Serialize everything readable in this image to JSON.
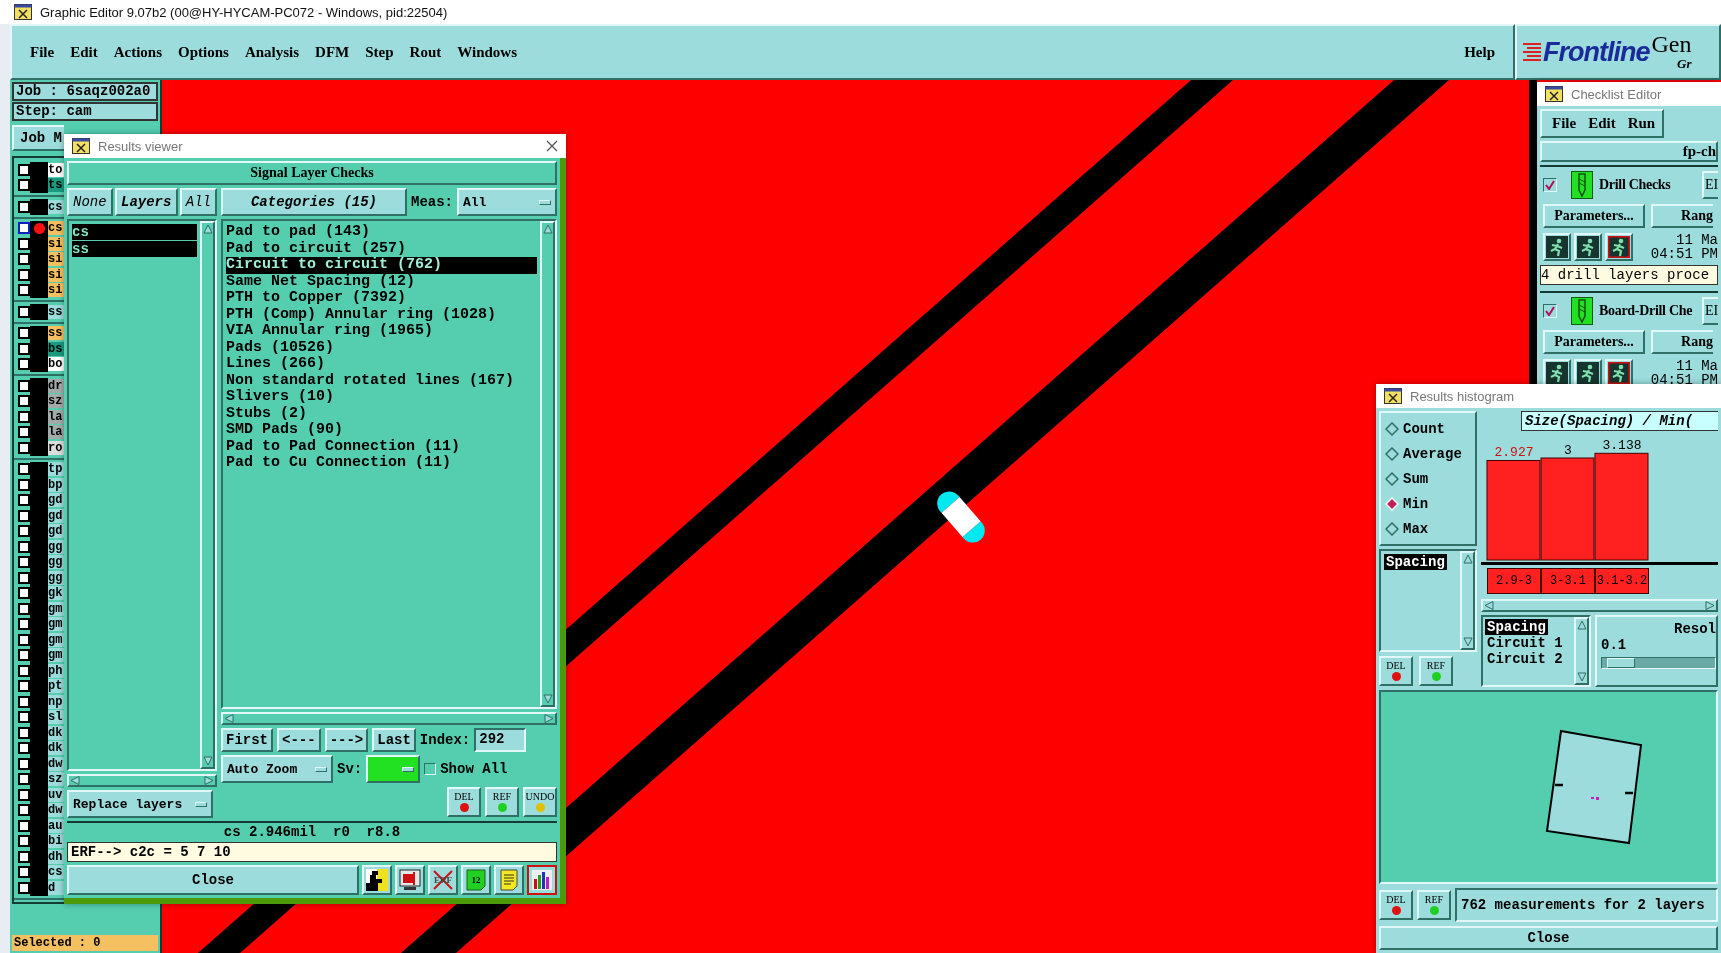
{
  "title_bar": {
    "title": "Graphic Editor 9.07b2 (00@HY-HYCAM-PC072 - Windows, pid:22504)"
  },
  "menu": {
    "items": [
      "File",
      "Edit",
      "Actions",
      "Options",
      "Analysis",
      "DFM",
      "Step",
      "Rout",
      "Windows"
    ],
    "help": "Help"
  },
  "logo": {
    "brand": "Frontline",
    "product": "Gen",
    "tagline": "Gr"
  },
  "job_panel": {
    "job": "Job : 6saqz002a0",
    "step": "Step: cam",
    "matrix_button": "Job M",
    "selected": "Selected : 0",
    "layer_groups": [
      [
        {
          "name": "to",
          "color": "#ffffff",
          "active": false,
          "checked": false
        },
        {
          "name": "ts",
          "color": "#1a9a80",
          "active": false,
          "checked": false
        }
      ],
      [
        {
          "name": "cs",
          "color": "#9cdcdc",
          "active": false,
          "checked": false
        }
      ],
      [
        {
          "name": "cs",
          "color": "#f5c060",
          "active": true,
          "checked": false
        },
        {
          "name": "si",
          "color": "#f5c060",
          "active": false,
          "checked": false
        },
        {
          "name": "si",
          "color": "#f5c060",
          "active": false,
          "checked": false
        },
        {
          "name": "si",
          "color": "#f5c060",
          "active": false,
          "checked": false
        },
        {
          "name": "si",
          "color": "#f5c060",
          "active": false,
          "checked": false
        }
      ],
      [
        {
          "name": "ss",
          "color": "#9cdcdc",
          "active": false,
          "checked": false
        }
      ],
      [
        {
          "name": "ss",
          "color": "#f5c060",
          "active": false,
          "checked": false
        },
        {
          "name": "bs",
          "color": "#1a9a80",
          "active": false,
          "checked": false
        },
        {
          "name": "bo",
          "color": "#ffffff",
          "active": false,
          "checked": false
        }
      ],
      [
        {
          "name": "dr",
          "color": "#a3aaaa",
          "active": false,
          "checked": false
        },
        {
          "name": "sz",
          "color": "#a3aaaa",
          "active": false,
          "checked": false
        },
        {
          "name": "la",
          "color": "#a3aaaa",
          "active": false,
          "checked": false
        },
        {
          "name": "la",
          "color": "#a3aaaa",
          "active": false,
          "checked": false
        },
        {
          "name": "ro",
          "color": "#dcdede",
          "active": false,
          "checked": false
        }
      ],
      [
        {
          "name": "tp",
          "color": "#9cdcdc",
          "active": false,
          "checked": false
        },
        {
          "name": "bp",
          "color": "#9cdcdc",
          "active": false,
          "checked": false
        },
        {
          "name": "gd",
          "color": "#9cdcdc",
          "active": false,
          "checked": false
        },
        {
          "name": "gd",
          "color": "#9cdcdc",
          "active": false,
          "checked": false
        },
        {
          "name": "gd",
          "color": "#9cdcdc",
          "active": false,
          "checked": false
        },
        {
          "name": "gg",
          "color": "#9cdcdc",
          "active": false,
          "checked": false
        },
        {
          "name": "gg",
          "color": "#9cdcdc",
          "active": false,
          "checked": false
        },
        {
          "name": "gg",
          "color": "#9cdcdc",
          "active": false,
          "checked": false
        },
        {
          "name": "gk",
          "color": "#9cdcdc",
          "active": false,
          "checked": false
        },
        {
          "name": "gm",
          "color": "#9cdcdc",
          "active": false,
          "checked": false
        },
        {
          "name": "gm",
          "color": "#9cdcdc",
          "active": false,
          "checked": false
        },
        {
          "name": "gm",
          "color": "#9cdcdc",
          "active": false,
          "checked": false
        },
        {
          "name": "gm",
          "color": "#9cdcdc",
          "active": false,
          "checked": false
        },
        {
          "name": "ph",
          "color": "#9cdcdc",
          "active": false,
          "checked": false
        },
        {
          "name": "pt",
          "color": "#9cdcdc",
          "active": false,
          "checked": false
        },
        {
          "name": "np",
          "color": "#9cdcdc",
          "active": false,
          "checked": false
        },
        {
          "name": "sl",
          "color": "#9cdcdc",
          "active": false,
          "checked": false
        },
        {
          "name": "dk",
          "color": "#9cdcdc",
          "active": false,
          "checked": false
        },
        {
          "name": "dk",
          "color": "#9cdcdc",
          "active": false,
          "checked": false
        },
        {
          "name": "dw",
          "color": "#9cdcdc",
          "active": false,
          "checked": false
        },
        {
          "name": "sz",
          "color": "#9cdcdc",
          "active": false,
          "checked": false
        },
        {
          "name": "uv",
          "color": "#9cdcdc",
          "active": false,
          "checked": false
        },
        {
          "name": "dw",
          "color": "#9cdcdc",
          "active": false,
          "checked": false
        },
        {
          "name": "au",
          "color": "#9cdcdc",
          "active": false,
          "checked": false
        },
        {
          "name": "bi",
          "color": "#9cdcdc",
          "active": false,
          "checked": false
        },
        {
          "name": "dh",
          "color": "#9cdcdc",
          "active": false,
          "checked": false
        },
        {
          "name": "cs",
          "color": "#9cdcdc",
          "active": false,
          "checked": false
        },
        {
          "name": "d",
          "color": "#9cdcdc",
          "active": false,
          "checked": false
        }
      ]
    ]
  },
  "results_viewer": {
    "title": "Results viewer",
    "header": "Signal Layer Checks",
    "layer_buttons": [
      "None",
      "Layers",
      "All"
    ],
    "layers": [
      {
        "name": "cs",
        "selected": true
      },
      {
        "name": "ss",
        "selected": true
      }
    ],
    "categories_button": "Categories (15)",
    "meas_label": "Meas:",
    "meas_value": "All",
    "categories": [
      {
        "label": "Pad to pad (143)",
        "selected": false
      },
      {
        "label": "Pad to circuit (257)",
        "selected": false
      },
      {
        "label": "Circuit to circuit (762)",
        "selected": true
      },
      {
        "label": "Same Net Spacing (12)",
        "selected": false
      },
      {
        "label": "PTH to Copper (7392)",
        "selected": false
      },
      {
        "label": "PTH (Comp) Annular ring (1028)",
        "selected": false
      },
      {
        "label": "VIA Annular ring (1965)",
        "selected": false
      },
      {
        "label": "Pads (10526)",
        "selected": false
      },
      {
        "label": "Lines (266)",
        "selected": false
      },
      {
        "label": "Non standard rotated lines (167)",
        "selected": false
      },
      {
        "label": "Slivers (10)",
        "selected": false
      },
      {
        "label": "Stubs (2)",
        "selected": false
      },
      {
        "label": "SMD Pads (90)",
        "selected": false
      },
      {
        "label": "Pad to Pad Connection (11)",
        "selected": false
      },
      {
        "label": "Pad to Cu Connection (11)",
        "selected": false
      }
    ],
    "nav_buttons": [
      "First",
      "<---",
      "--->",
      "Last"
    ],
    "index_label": "Index:",
    "index_value": "292",
    "zoom_mode": "Auto Zoom",
    "sv_label": "Sv:",
    "show_all": {
      "label": "Show All",
      "checked": false
    },
    "replace_mode": "Replace layers",
    "edit_buttons": [
      {
        "label": "DEL",
        "kind": "delete"
      },
      {
        "label": "REF",
        "kind": "refresh"
      },
      {
        "label": "UNDO",
        "kind": "undo"
      }
    ],
    "status": "cs 2.946mil  r0  r8.8",
    "erf_line": "ERF--> c2c = 5 7 10",
    "close": "Close",
    "tools": [
      {
        "kind": "figure",
        "selected": false
      },
      {
        "kind": "monitor",
        "selected": false
      },
      {
        "kind": "erf",
        "label": "ERF",
        "selected": false
      },
      {
        "kind": "page",
        "label": "12",
        "selected": false
      },
      {
        "kind": "notes",
        "selected": false
      },
      {
        "kind": "chart",
        "selected": true
      }
    ]
  },
  "checklist_editor": {
    "title": "Checklist Editor",
    "menu": [
      "File",
      "Edit",
      "Run"
    ],
    "checklist_name": "fp-ch",
    "actions": [
      {
        "name": "Drill Checks",
        "checked": true,
        "erf_button": "EI",
        "buttons": [
          "Parameters...",
          "Rang"
        ],
        "date": "11 Ma",
        "time": "04:51 PM",
        "message": "4 drill layers proce"
      },
      {
        "name": "Board-Drill Che",
        "checked": true,
        "erf_button": "EI",
        "buttons": [
          "Parameters...",
          "Rang"
        ],
        "date": "11 Ma",
        "time": "04:51 PM"
      }
    ]
  },
  "results_histogram": {
    "title": "Results histogram",
    "modes": [
      {
        "label": "Count",
        "selected": false
      },
      {
        "label": "Average",
        "selected": false
      },
      {
        "label": "Sum",
        "selected": false
      },
      {
        "label": "Min",
        "selected": true
      },
      {
        "label": "Max",
        "selected": false
      }
    ],
    "fields": [
      {
        "label": "Spacing",
        "selected": true
      }
    ],
    "field_buttons": [
      {
        "label": "DEL",
        "kind": "delete"
      },
      {
        "label": "REF",
        "kind": "refresh"
      }
    ],
    "chart_data": {
      "type": "bar",
      "title": "Size(Spacing) / Min(",
      "categories": [
        "2.9-3",
        "3-3.1",
        "3.1-3.2"
      ],
      "values": [
        2.927,
        3,
        3.138
      ],
      "data_labels": true
    },
    "columns": [
      {
        "label": "Spacing",
        "selected": true
      },
      {
        "label": "Circuit 1",
        "selected": false
      },
      {
        "label": "Circuit 2",
        "selected": false
      }
    ],
    "resolution_label": "Resol",
    "resolution_value": "0.1",
    "resolution_slider": {
      "level": 0.04
    },
    "footer_buttons": [
      {
        "label": "DEL",
        "kind": "delete"
      },
      {
        "label": "REF",
        "kind": "refresh"
      }
    ],
    "summary": "762 measurements for 2 layers",
    "close": "Close"
  }
}
